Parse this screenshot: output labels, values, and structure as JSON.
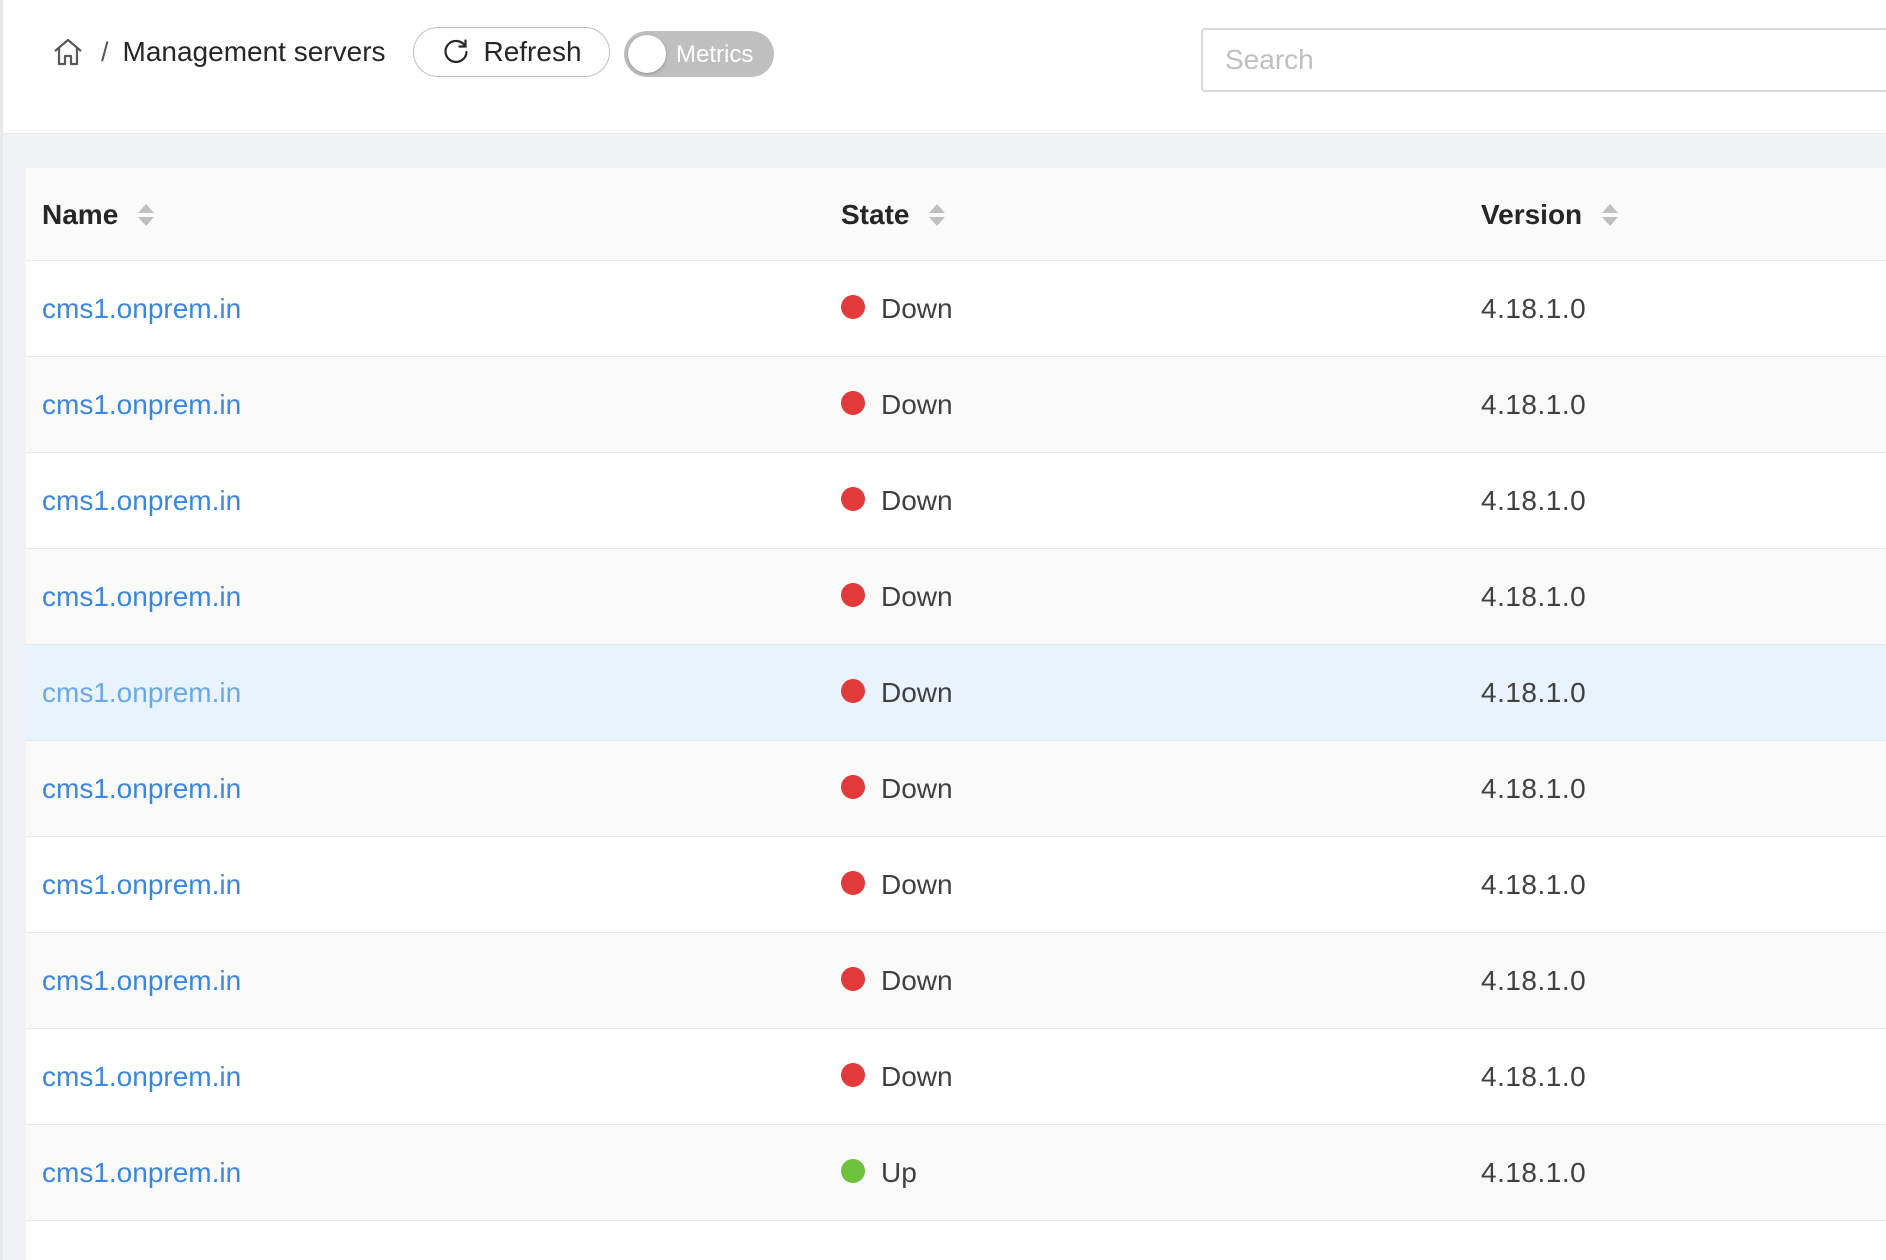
{
  "breadcrumb": {
    "home_icon": "home-icon",
    "separator": "/",
    "title": "Management servers"
  },
  "toolbar": {
    "refresh_label": "Refresh",
    "refresh_icon": "reload-icon",
    "metrics_label": "Metrics",
    "metrics_enabled": false
  },
  "search": {
    "placeholder": "Search",
    "value": ""
  },
  "colors": {
    "link": "#3a87e0",
    "down": "#e03a3a",
    "up": "#6cc23a",
    "highlight_row": "#e8f3fe"
  },
  "table": {
    "columns": [
      "Name",
      "State",
      "Version"
    ],
    "rows": [
      {
        "name": "cms1.onprem.in",
        "state": "Down",
        "state_color": "#e03a3a",
        "version": "4.18.1.0"
      },
      {
        "name": "cms1.onprem.in",
        "state": "Down",
        "state_color": "#e03a3a",
        "version": "4.18.1.0"
      },
      {
        "name": "cms1.onprem.in",
        "state": "Down",
        "state_color": "#e03a3a",
        "version": "4.18.1.0"
      },
      {
        "name": "cms1.onprem.in",
        "state": "Down",
        "state_color": "#e03a3a",
        "version": "4.18.1.0"
      },
      {
        "name": "cms1.onprem.in",
        "state": "Down",
        "state_color": "#e03a3a",
        "version": "4.18.1.0",
        "highlighted": true
      },
      {
        "name": "cms1.onprem.in",
        "state": "Down",
        "state_color": "#e03a3a",
        "version": "4.18.1.0"
      },
      {
        "name": "cms1.onprem.in",
        "state": "Down",
        "state_color": "#e03a3a",
        "version": "4.18.1.0"
      },
      {
        "name": "cms1.onprem.in",
        "state": "Down",
        "state_color": "#e03a3a",
        "version": "4.18.1.0"
      },
      {
        "name": "cms1.onprem.in",
        "state": "Down",
        "state_color": "#e03a3a",
        "version": "4.18.1.0"
      },
      {
        "name": "cms1.onprem.in",
        "state": "Up",
        "state_color": "#6cc23a",
        "version": "4.18.1.0"
      }
    ]
  }
}
